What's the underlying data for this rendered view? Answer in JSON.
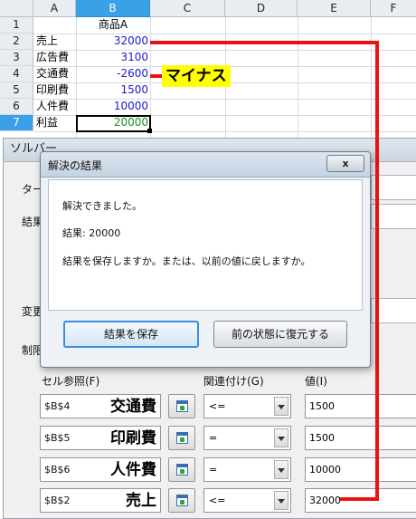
{
  "sheet": {
    "columns": [
      "A",
      "B",
      "C",
      "D",
      "E",
      "F"
    ],
    "rows": [
      "1",
      "2",
      "3",
      "4",
      "5",
      "6",
      "7"
    ],
    "cells": [
      {
        "a": "",
        "b": "商品A"
      },
      {
        "a": "売上",
        "b": "32000"
      },
      {
        "a": "広告費",
        "b": "3100"
      },
      {
        "a": "交通費",
        "b": "-2600"
      },
      {
        "a": "印刷費",
        "b": "1500"
      },
      {
        "a": "人件費",
        "b": "10000"
      },
      {
        "a": "利益",
        "b": "20000"
      }
    ],
    "selected_column": "B",
    "selected_row": "7"
  },
  "annotation": {
    "label": "マイナス",
    "line_color": "#ee1111",
    "label_bg": "#ffff00"
  },
  "solver": {
    "title": "ソルバー",
    "frag_target": "ター",
    "frag_result": "結果",
    "frag_change": "変更",
    "frag_constraint": "制限",
    "headers": {
      "cell_ref": "セル参照(F)",
      "relation": "関連付け(G)",
      "value": "値(I)"
    },
    "constraints": [
      {
        "ref": "$B$4",
        "label": "交通費",
        "op": "<=",
        "value": "1500"
      },
      {
        "ref": "$B$5",
        "label": "印刷費",
        "op": "=",
        "value": "1500"
      },
      {
        "ref": "$B$6",
        "label": "人件費",
        "op": "=",
        "value": "10000"
      },
      {
        "ref": "$B$2",
        "label": "売上",
        "op": "<=",
        "value": "32000"
      }
    ]
  },
  "result_dialog": {
    "title": "解決の結果",
    "close_label": "x",
    "line1": "解決できました。",
    "line2": "結果: 20000",
    "line3": "結果を保存しますか。または、以前の値に戻しますか。",
    "save_label": "結果を保存",
    "restore_label": "前の状態に復元する"
  }
}
